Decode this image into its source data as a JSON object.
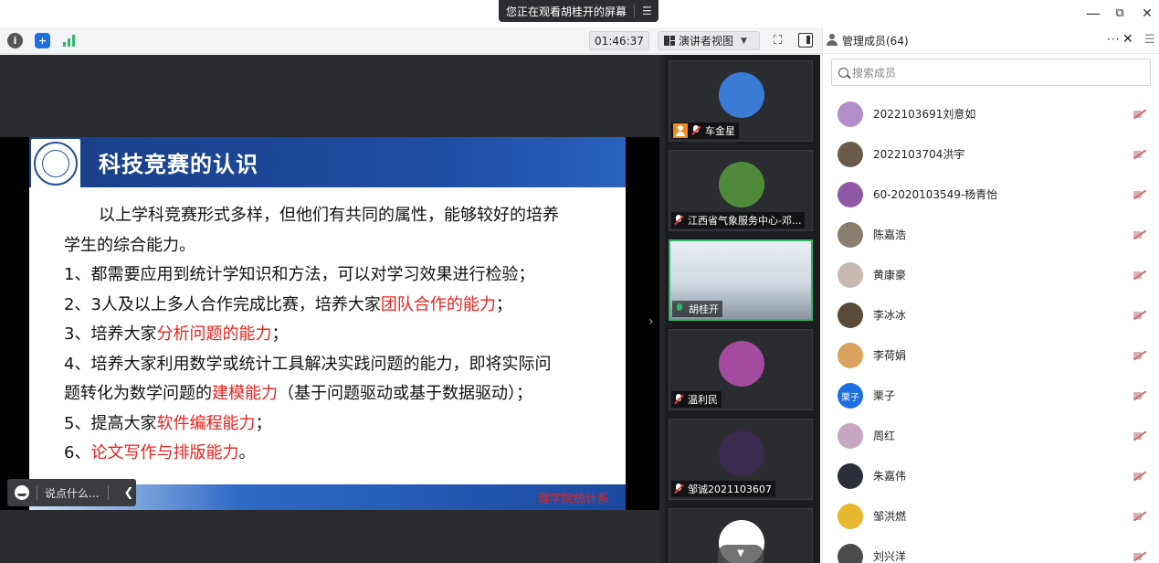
{
  "window": {
    "share_notice": "您正在观看胡桂开的屏幕",
    "menu_icon": "menu-icon",
    "minimize": "—",
    "restore": "⧉",
    "close": "✕"
  },
  "toolbar": {
    "timer": "01:46:37",
    "view_mode": "演讲者视图",
    "icons": [
      "info-icon",
      "shield-icon",
      "signal-icon",
      "fullscreen-icon",
      "layout-icon"
    ]
  },
  "slide": {
    "title": "科技竞赛的认识",
    "lines": [
      [
        {
          "t": "　　以上学科竞赛形式多样，但他们有共同的属性，能够较好的培养",
          "red": false
        }
      ],
      [
        {
          "t": "学生的综合能力。",
          "red": false
        }
      ],
      [
        {
          "t": "1、都需要应用到统计学知识和方法，可以对学习效果进行检验；",
          "red": false
        }
      ],
      [
        {
          "t": "2、3人及以上多人合作完成比赛，培养大家",
          "red": false
        },
        {
          "t": "团队合作的能力",
          "red": true
        },
        {
          "t": "；",
          "red": false
        }
      ],
      [
        {
          "t": "3、培养大家",
          "red": false
        },
        {
          "t": "分析问题的能力",
          "red": true
        },
        {
          "t": "；",
          "red": false
        }
      ],
      [
        {
          "t": "4、培养大家利用数学或统计工具解决实践问题的能力，即将实际问",
          "red": false
        }
      ],
      [
        {
          "t": "题转化为数学问题的",
          "red": false
        },
        {
          "t": "建模能力",
          "red": true
        },
        {
          "t": "（基于问题驱动或基于数据驱动）；",
          "red": false
        }
      ],
      [
        {
          "t": "5、提高大家",
          "red": false
        },
        {
          "t": "软件编程能力",
          "red": true
        },
        {
          "t": "；",
          "red": false
        }
      ],
      [
        {
          "t": "6、",
          "red": false
        },
        {
          "t": "论文写作与排版能力",
          "red": true
        },
        {
          "t": "。",
          "red": false
        }
      ]
    ],
    "footer_dept": "理学院统计系"
  },
  "chat": {
    "placeholder": "说点什么..."
  },
  "videos": [
    {
      "name": "车金星",
      "host": true,
      "mic_on": false,
      "active": false,
      "avatar_color": "#3a7bd5"
    },
    {
      "name": "江西省气象服务中心-邓...",
      "host": false,
      "mic_on": false,
      "active": false,
      "avatar_color": "#4f8a3a"
    },
    {
      "name": "胡桂开",
      "host": false,
      "mic_on": true,
      "active": true,
      "avatar_color": "#c9d4de"
    },
    {
      "name": "温利民",
      "host": false,
      "mic_on": false,
      "active": false,
      "avatar_color": "#a24ba0"
    },
    {
      "name": "邹诚2021103607",
      "host": false,
      "mic_on": false,
      "active": false,
      "avatar_color": "#3b2a4f"
    },
    {
      "name": "",
      "host": false,
      "mic_on": false,
      "active": false,
      "avatar_color": "#ffffff"
    }
  ],
  "members_panel": {
    "title": "管理成员(64)",
    "more": "···",
    "close": "✕",
    "search_placeholder": "搜索成员",
    "members": [
      {
        "name": "2022103691刘意如",
        "avatar_color": "#b48ec9",
        "avatar_text": ""
      },
      {
        "name": "2022103704洪宇",
        "avatar_color": "#6b5a4a",
        "avatar_text": ""
      },
      {
        "name": "60-2020103549-杨青怡",
        "avatar_color": "#8e5aa8",
        "avatar_text": ""
      },
      {
        "name": "陈嘉浩",
        "avatar_color": "#8a7f6e",
        "avatar_text": ""
      },
      {
        "name": "黄康豪",
        "avatar_color": "#c7b9b1",
        "avatar_text": ""
      },
      {
        "name": "李冰冰",
        "avatar_color": "#5a4a3a",
        "avatar_text": ""
      },
      {
        "name": "李荷娟",
        "avatar_color": "#d9a35e",
        "avatar_text": ""
      },
      {
        "name": "栗子",
        "avatar_color": "#1e6fe0",
        "avatar_text": "栗子"
      },
      {
        "name": "周红",
        "avatar_color": "#c8a7c2",
        "avatar_text": ""
      },
      {
        "name": "朱嘉伟",
        "avatar_color": "#2b2d38",
        "avatar_text": ""
      },
      {
        "name": "邹洪燃",
        "avatar_color": "#e7b72f",
        "avatar_text": ""
      },
      {
        "name": "刘兴洋",
        "avatar_color": "#4a4a4a",
        "avatar_text": ""
      }
    ]
  }
}
